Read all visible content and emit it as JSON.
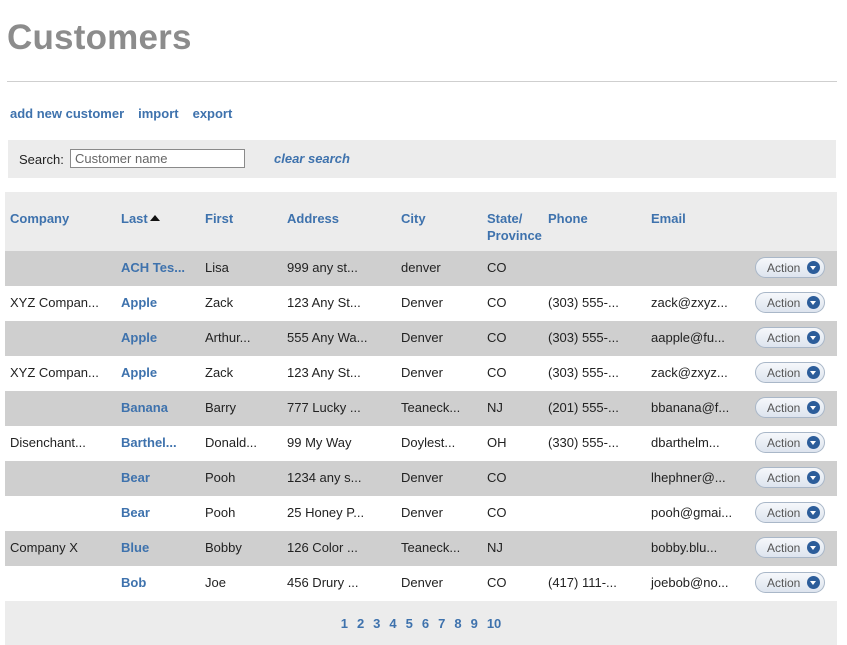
{
  "page": {
    "title": "Customers"
  },
  "toolbar": {
    "links": [
      {
        "name": "add-new-customer-link",
        "label": "add new customer"
      },
      {
        "name": "import-link",
        "label": "import"
      },
      {
        "name": "export-link",
        "label": "export"
      }
    ]
  },
  "search": {
    "label": "Search:",
    "placeholder": "Customer name",
    "value": "",
    "clear_label": "clear search"
  },
  "table": {
    "columns": [
      {
        "key": "company",
        "label": "Company"
      },
      {
        "key": "last",
        "label": "Last",
        "sorted": "asc"
      },
      {
        "key": "first",
        "label": "First"
      },
      {
        "key": "address",
        "label": "Address"
      },
      {
        "key": "city",
        "label": "City"
      },
      {
        "key": "state",
        "label": "State/ Province"
      },
      {
        "key": "phone",
        "label": "Phone"
      },
      {
        "key": "email",
        "label": "Email"
      }
    ],
    "action_label": "Action",
    "rows": [
      {
        "company": "",
        "last": "ACH Tes...",
        "first": "Lisa",
        "address": "999 any st...",
        "city": "denver",
        "state": "CO",
        "phone": "",
        "email": ""
      },
      {
        "company": "XYZ Compan...",
        "last": "Apple",
        "first": "Zack",
        "address": "123 Any St...",
        "city": "Denver",
        "state": "CO",
        "phone": "(303) 555-...",
        "email": "zack@zxyz..."
      },
      {
        "company": "",
        "last": "Apple",
        "first": "Arthur...",
        "address": "555 Any Wa...",
        "city": "Denver",
        "state": "CO",
        "phone": "(303) 555-...",
        "email": "aapple@fu..."
      },
      {
        "company": "XYZ Compan...",
        "last": "Apple",
        "first": "Zack",
        "address": "123 Any St...",
        "city": "Denver",
        "state": "CO",
        "phone": "(303) 555-...",
        "email": "zack@zxyz..."
      },
      {
        "company": "",
        "last": "Banana",
        "first": "Barry",
        "address": "777 Lucky ...",
        "city": "Teaneck...",
        "state": "NJ",
        "phone": "(201) 555-...",
        "email": "bbanana@f..."
      },
      {
        "company": "Disenchant...",
        "last": "Barthel...",
        "first": "Donald...",
        "address": "99 My Way",
        "city": "Doylest...",
        "state": "OH",
        "phone": "(330) 555-...",
        "email": "dbarthelm..."
      },
      {
        "company": "",
        "last": "Bear",
        "first": "Pooh",
        "address": "1234 any s...",
        "city": "Denver",
        "state": "CO",
        "phone": "",
        "email": "lhephner@..."
      },
      {
        "company": "",
        "last": "Bear",
        "first": "Pooh",
        "address": "25 Honey P...",
        "city": "Denver",
        "state": "CO",
        "phone": "",
        "email": "pooh@gmai..."
      },
      {
        "company": "Company X",
        "last": "Blue",
        "first": "Bobby",
        "address": "126 Color ...",
        "city": "Teaneck...",
        "state": "NJ",
        "phone": "",
        "email": "bobby.blu..."
      },
      {
        "company": "",
        "last": "Bob",
        "first": "Joe",
        "address": "456 Drury ...",
        "city": "Denver",
        "state": "CO",
        "phone": "(417) 111-...",
        "email": "joebob@no..."
      }
    ]
  },
  "pagination": {
    "pages": [
      "1",
      "2",
      "3",
      "4",
      "5",
      "6",
      "7",
      "8",
      "9",
      "10"
    ]
  }
}
